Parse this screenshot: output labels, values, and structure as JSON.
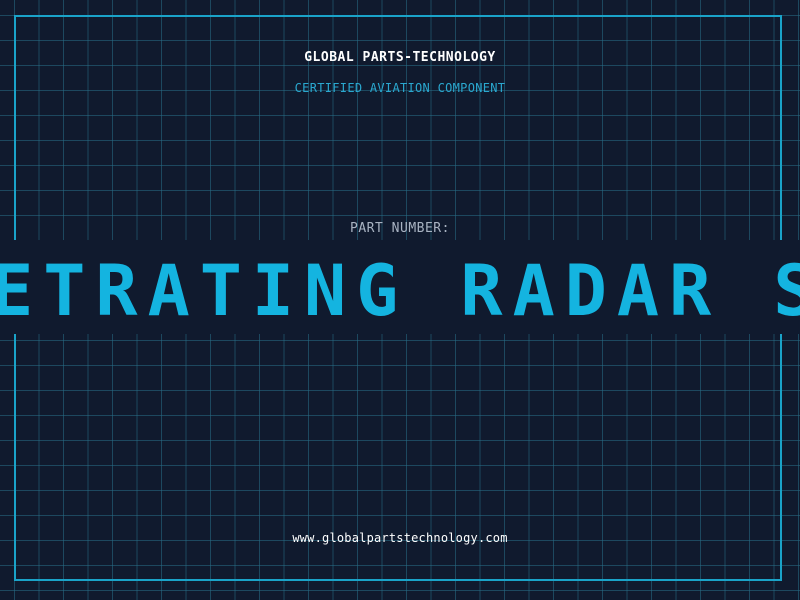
{
  "header": {
    "brand": "GLOBAL PARTS-TECHNOLOGY",
    "subtitle": "CERTIFIED AVIATION COMPONENT"
  },
  "part": {
    "label": "PART NUMBER:",
    "number": "NETRATING RADAR SYS"
  },
  "footer": {
    "website": "www.globalpartstechnology.com"
  },
  "colors": {
    "background": "#101a2e",
    "grid": "#286e87",
    "frame": "#1aa3c9",
    "accent": "#14b4e0",
    "brand_text": "#ffffff",
    "label_text": "#a9b3c2"
  }
}
